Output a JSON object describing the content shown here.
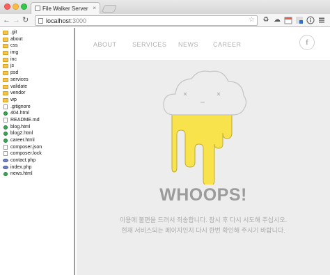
{
  "window": {
    "tab_title": "File Walker Server",
    "tab_close_glyph": "×"
  },
  "toolbar": {
    "back_glyph": "←",
    "forward_glyph": "→",
    "reload_glyph": "↻",
    "url_host": "localhost",
    "url_port": ":3000",
    "star_glyph": "☆",
    "extensions": [
      "recycle-icon",
      "cloud-icon",
      "calendar-icon",
      "mail-icon",
      "info-icon",
      "menu-icon"
    ]
  },
  "sidebar": {
    "files": [
      {
        "name": ".git",
        "type": "folder"
      },
      {
        "name": "about",
        "type": "folder"
      },
      {
        "name": "css",
        "type": "folder"
      },
      {
        "name": "img",
        "type": "folder"
      },
      {
        "name": "inc",
        "type": "folder"
      },
      {
        "name": "js",
        "type": "folder"
      },
      {
        "name": "psd",
        "type": "folder"
      },
      {
        "name": "services",
        "type": "folder"
      },
      {
        "name": "validate",
        "type": "folder"
      },
      {
        "name": "vendor",
        "type": "folder"
      },
      {
        "name": "wp",
        "type": "folder"
      },
      {
        "name": ".gitignore",
        "type": "doc"
      },
      {
        "name": "404.html",
        "type": "html"
      },
      {
        "name": "README.md",
        "type": "doc"
      },
      {
        "name": "blog.html",
        "type": "html"
      },
      {
        "name": "blog2.html",
        "type": "html"
      },
      {
        "name": "career.html",
        "type": "html"
      },
      {
        "name": "composer.json",
        "type": "doc"
      },
      {
        "name": "composer.lock",
        "type": "doc"
      },
      {
        "name": "contact.php",
        "type": "php"
      },
      {
        "name": "index.php",
        "type": "php"
      },
      {
        "name": "news.html",
        "type": "html"
      }
    ]
  },
  "page": {
    "nav": [
      "ABOUT",
      "SERVICES",
      "NEWS",
      "CAREER"
    ],
    "facebook_glyph": "f",
    "heading": "WHOOPS!",
    "message_line1": "이용에 불편을 드려서 죄송합니다. 잠시 후 다시 시도해 주십시오.",
    "message_line2": "현재 서비스되는 페이지인지 다시 한번 확인해 주시기 바랍니다.",
    "colors": {
      "drip_yellow": "#f8e34d",
      "cloud_outline": "#c4c4c4",
      "heading_gray": "#9b9b9b"
    }
  }
}
